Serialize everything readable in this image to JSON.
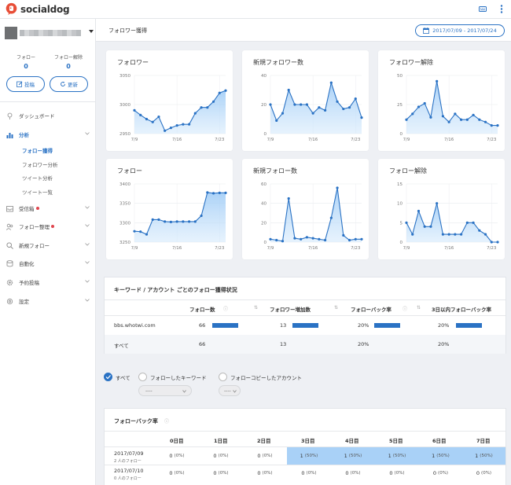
{
  "app": {
    "logo_text": "socialdog",
    "brand_color": "#e84e37",
    "accent_color": "#2a72c4"
  },
  "sidebar": {
    "stats": [
      {
        "label": "フォロー",
        "value": "0"
      },
      {
        "label": "フォロー解除",
        "value": "0"
      }
    ],
    "post_button": "投稿",
    "refresh_button": "更新",
    "nav": [
      {
        "label": "ダッシュボード",
        "icon": "pin-icon",
        "chevron": false,
        "dot": false
      },
      {
        "label": "分析",
        "icon": "bar-chart-icon",
        "chevron": true,
        "dot": false,
        "active": true
      },
      {
        "label": "受信箱",
        "icon": "inbox-icon",
        "chevron": true,
        "dot": true
      },
      {
        "label": "フォロー整理",
        "icon": "users-icon",
        "chevron": true,
        "dot": true
      },
      {
        "label": "新規フォロー",
        "icon": "search-icon",
        "chevron": true,
        "dot": false
      },
      {
        "label": "自動化",
        "icon": "database-icon",
        "chevron": true,
        "dot": false
      },
      {
        "label": "予約投稿",
        "icon": "gear-icon",
        "chevron": true,
        "dot": false
      },
      {
        "label": "設定",
        "icon": "settings-icon",
        "chevron": true,
        "dot": false
      }
    ],
    "subnav": [
      "フォロー獲得",
      "フォロワー分析",
      "ツイート分析",
      "ツイート一覧"
    ]
  },
  "header": {
    "title": "フォロワー獲得",
    "date_range": "2017/07/09  -  2017/07/24"
  },
  "chart_data": [
    {
      "type": "line",
      "title": "フォロワー",
      "ylim": [
        2950,
        3050
      ],
      "yticks": [
        "3050",
        "3000",
        "2950"
      ],
      "xticks": [
        "7/9",
        "7/16",
        "7/23"
      ],
      "x": [
        9,
        10,
        11,
        12,
        13,
        14,
        15,
        16,
        17,
        18,
        19,
        20,
        21,
        22,
        23,
        24
      ],
      "values": [
        2990,
        2982,
        2975,
        2970,
        2979,
        2955,
        2960,
        2964,
        2966,
        2966,
        2985,
        2995,
        2995,
        3005,
        3020,
        3024
      ]
    },
    {
      "type": "line",
      "title": "新規フォロワー数",
      "ylim": [
        0,
        40
      ],
      "yticks": [
        "40",
        "20",
        "0"
      ],
      "xticks": [
        "7/9",
        "7/16",
        "7/23"
      ],
      "x": [
        9,
        10,
        11,
        12,
        13,
        14,
        15,
        16,
        17,
        18,
        19,
        20,
        21,
        22,
        23,
        24
      ],
      "values": [
        20,
        9,
        14,
        30,
        20,
        20,
        20,
        14,
        18,
        16,
        35,
        22,
        17,
        18,
        24,
        11
      ]
    },
    {
      "type": "line",
      "title": "フォロワー解除",
      "ylim": [
        0,
        50
      ],
      "yticks": [
        "50",
        "25",
        "0"
      ],
      "xticks": [
        "7/9",
        "7/16",
        "7/23"
      ],
      "x": [
        9,
        10,
        11,
        12,
        13,
        14,
        15,
        16,
        17,
        18,
        19,
        20,
        21,
        22,
        23,
        24
      ],
      "values": [
        12,
        17,
        23,
        26,
        14,
        45,
        15,
        10,
        17,
        12,
        12,
        16,
        12,
        10,
        7,
        7
      ]
    },
    {
      "type": "area",
      "title": "フォロー",
      "ylim": [
        3250,
        3400
      ],
      "yticks": [
        "3400",
        "3350",
        "3300",
        "3250"
      ],
      "xticks": [
        "7/9",
        "7/16",
        "7/23"
      ],
      "x": [
        9,
        10,
        11,
        12,
        13,
        14,
        15,
        16,
        17,
        18,
        19,
        20,
        21,
        22,
        23,
        24
      ],
      "values": [
        3278,
        3277,
        3270,
        3308,
        3308,
        3303,
        3302,
        3303,
        3303,
        3303,
        3303,
        3318,
        3378,
        3376,
        3377,
        3377
      ]
    },
    {
      "type": "line",
      "title": "新規フォロー数",
      "ylim": [
        0,
        60
      ],
      "yticks": [
        "60",
        "40",
        "20",
        "0"
      ],
      "xticks": [
        "7/9",
        "7/16",
        "7/23"
      ],
      "x": [
        9,
        10,
        11,
        12,
        13,
        14,
        15,
        16,
        17,
        18,
        19,
        20,
        21,
        22,
        23,
        24
      ],
      "values": [
        3,
        2,
        1,
        45,
        4,
        3,
        5,
        4,
        3,
        2,
        25,
        56,
        7,
        2,
        3,
        3
      ]
    },
    {
      "type": "line",
      "title": "フォロー解除",
      "ylim": [
        0,
        15
      ],
      "yticks": [
        "15",
        "10",
        "5",
        "0"
      ],
      "xticks": [
        "7/9",
        "7/16",
        "7/23"
      ],
      "x": [
        9,
        10,
        11,
        12,
        13,
        14,
        15,
        16,
        17,
        18,
        19,
        20,
        21,
        22,
        23,
        24
      ],
      "values": [
        5,
        2,
        8,
        4,
        4,
        10,
        2,
        2,
        2,
        2,
        5,
        5,
        3,
        2,
        0,
        0
      ]
    }
  ],
  "keyword_table": {
    "title": "キーワード / アカウント ごとのフォロー獲得状況",
    "columns": [
      "フォロー数",
      "フォロワー増加数",
      "フォローバック率",
      "3日以内フォローバック率"
    ],
    "rows": [
      {
        "name": "bbs.whotwi.com",
        "values": [
          "66",
          "13",
          "20%",
          "20%"
        ],
        "bars": true
      },
      {
        "name": "すべて",
        "values": [
          "66",
          "13",
          "20%",
          "20%"
        ],
        "bars": false
      }
    ]
  },
  "filters": {
    "options": [
      "すべて",
      "フォローしたキーワード",
      "フォローコピーしたアカウント"
    ],
    "selects": [
      "----",
      "----"
    ]
  },
  "followback": {
    "title": "フォローバック率",
    "days": [
      "0日目",
      "1日目",
      "2日目",
      "3日目",
      "4日目",
      "5日目",
      "6日目",
      "7日目"
    ],
    "rows": [
      {
        "date": "2017/07/09",
        "sub": "2 人のフォロー",
        "cells": [
          [
            "0",
            "(0%)"
          ],
          [
            "0",
            "(0%)"
          ],
          [
            "0",
            "(0%)"
          ],
          [
            "1",
            "(50%)"
          ],
          [
            "1",
            "(50%)"
          ],
          [
            "1",
            "(50%)"
          ],
          [
            "1",
            "(50%)"
          ],
          [
            "1",
            "(50%)"
          ]
        ]
      },
      {
        "date": "2017/07/10",
        "sub": "0 人のフォロー",
        "cells": [
          [
            "0",
            "(0%)"
          ],
          [
            "0",
            "(0%)"
          ],
          [
            "0",
            "(0%)"
          ],
          [
            "0",
            "(0%)"
          ],
          [
            "0",
            "(0%)"
          ],
          [
            "0",
            "(0%)"
          ],
          [
            "0",
            "(0%)"
          ],
          [
            "0",
            "(0%)"
          ]
        ]
      }
    ]
  }
}
